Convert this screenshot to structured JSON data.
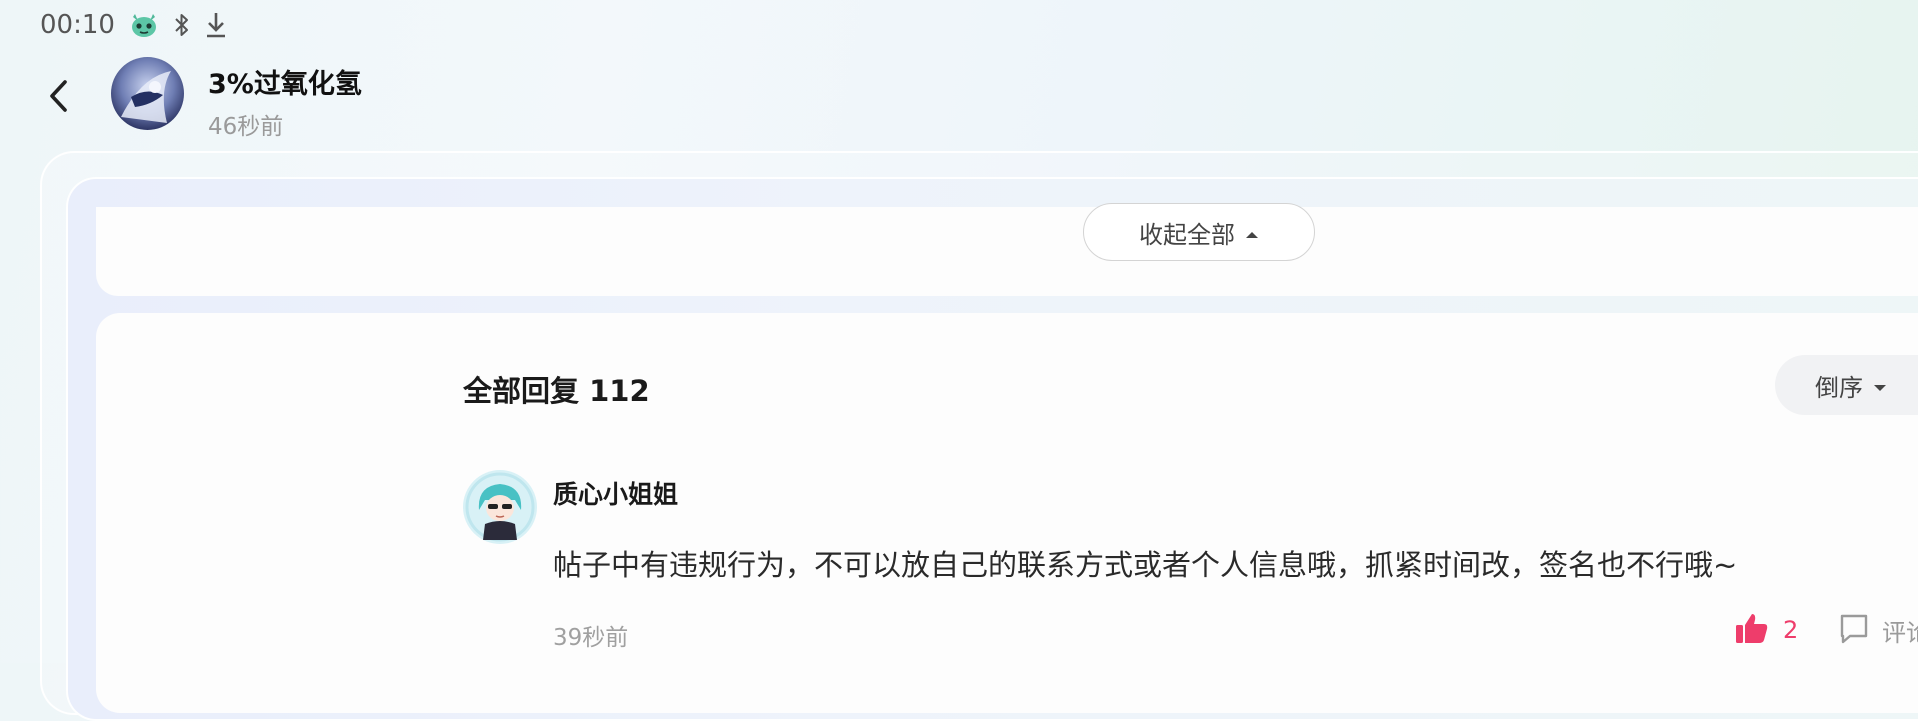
{
  "status_bar": {
    "time": "00:10",
    "icons": [
      "app-mascot-icon",
      "bluetooth-icon",
      "download-icon"
    ]
  },
  "header": {
    "back_icon": "chevron-left-icon",
    "title": "3%过氧化氢",
    "time": "46秒前"
  },
  "post": {
    "collapse_label": "收起全部",
    "collapse_icon": "caret-up-icon"
  },
  "replies": {
    "title": "全部回复 112",
    "sort_label": "倒序",
    "sort_icon": "caret-down-icon",
    "items": [
      {
        "author": "质心小姐姐",
        "text": "帖子中有违规行为，不可以放自己的联系方式或者个人信息哦，抓紧时间改，签名也不行哦~",
        "time": "39秒前",
        "likes": "2",
        "reply_label": "评论"
      }
    ]
  },
  "colors": {
    "accent_like": "#ee3d6b",
    "muted_text": "#9a9a9a"
  }
}
